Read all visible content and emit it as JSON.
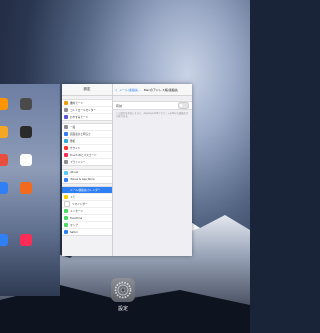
{
  "app_switcher": {
    "settings_app_name": "設定",
    "settings_icon": "gear-icon"
  },
  "settings": {
    "sidebar_title": "設定",
    "groups": [
      {
        "items": [
          {
            "label": "機内モード",
            "color": "#f39c12"
          },
          {
            "label": "コントロールセンター",
            "color": "#8e8e93"
          },
          {
            "label": "おやすみモード",
            "color": "#5856d6"
          }
        ]
      },
      {
        "items": [
          {
            "label": "一般",
            "color": "#8e8e93"
          },
          {
            "label": "画面表示と明るさ",
            "color": "#2f7ff5"
          },
          {
            "label": "壁紙",
            "color": "#34aadc"
          },
          {
            "label": "サウンド",
            "color": "#ff3b30"
          },
          {
            "label": "Touch IDとパスコード",
            "color": "#ff2d55"
          },
          {
            "label": "プライバシー",
            "color": "#8e8e93"
          }
        ]
      },
      {
        "items": [
          {
            "label": "iCloud",
            "color": "#5ac8fa"
          },
          {
            "label": "iTunes & App Store",
            "color": "#2f7ff5"
          }
        ]
      },
      {
        "items": [
          {
            "label": "メール/連絡先/カレンダー",
            "color": "#2f7ff5",
            "selected": true
          },
          {
            "label": "メモ",
            "color": "#ffcc00"
          },
          {
            "label": "リマインダー",
            "color": "#ffffff"
          },
          {
            "label": "メッセージ",
            "color": "#4cd964"
          },
          {
            "label": "FaceTime",
            "color": "#4cd964"
          },
          {
            "label": "マップ",
            "color": "#4cd964"
          },
          {
            "label": "Safari",
            "color": "#2f7ff5"
          }
        ]
      }
    ],
    "detail": {
      "back_label": "く メール/連絡先...",
      "title": "Macのアドレス帳/連絡先",
      "toggle_label": "有効",
      "toggle_state": "off",
      "footer_note": "この設定を有効にすると、AppleのLDAPアカウントをMacの連絡先から探せます。"
    }
  }
}
